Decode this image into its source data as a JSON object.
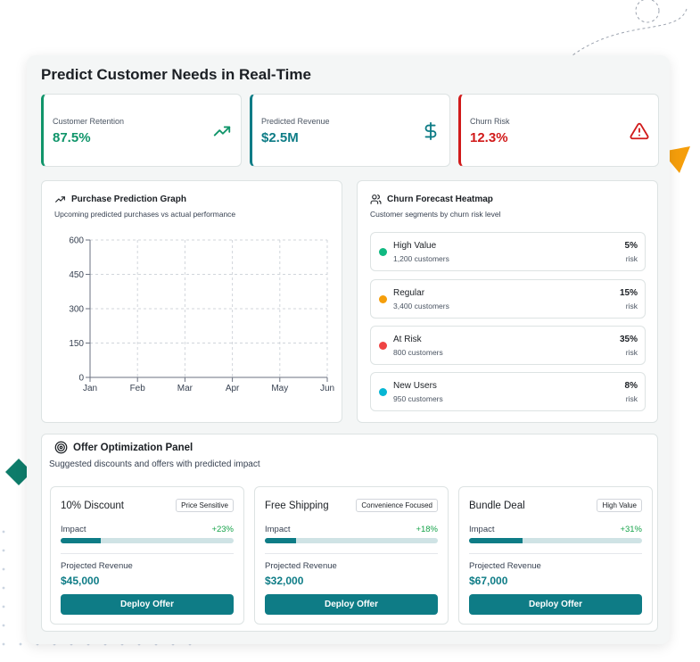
{
  "title": "Predict Customer Needs in Real-Time",
  "kpis": [
    {
      "label": "Customer Retention",
      "value": "87.5%",
      "color": "#10956a",
      "icon": "trending-up-icon"
    },
    {
      "label": "Predicted Revenue",
      "value": "$2.5M",
      "color": "#0e7c86",
      "icon": "dollar-icon"
    },
    {
      "label": "Churn Risk",
      "value": "12.3%",
      "color": "#d11a1a",
      "icon": "warning-icon"
    }
  ],
  "graph": {
    "title": "Purchase Prediction Graph",
    "subtitle": "Upcoming predicted purchases vs actual performance",
    "icon": "trending-up-icon"
  },
  "chart_data": {
    "type": "line",
    "categories": [
      "Jan",
      "Feb",
      "Mar",
      "Apr",
      "May",
      "Jun"
    ],
    "yticks": [
      "0",
      "150",
      "300",
      "450",
      "600"
    ],
    "ylim": [
      0,
      600
    ],
    "series": [],
    "grid": true
  },
  "heatmap": {
    "title": "Churn Forecast Heatmap",
    "subtitle": "Customer segments by churn risk level",
    "icon": "users-icon",
    "segments": [
      {
        "name": "High Value",
        "count": "1,200 customers",
        "pct": "5%",
        "risk": "risk",
        "color": "#10b981"
      },
      {
        "name": "Regular",
        "count": "3,400 customers",
        "pct": "15%",
        "risk": "risk",
        "color": "#f59e0b"
      },
      {
        "name": "At Risk",
        "count": "800 customers",
        "pct": "35%",
        "risk": "risk",
        "color": "#ef4444"
      },
      {
        "name": "New Users",
        "count": "950 customers",
        "pct": "8%",
        "risk": "risk",
        "color": "#06b6d4"
      }
    ]
  },
  "offers": {
    "title": "Offer Optimization Panel",
    "subtitle": "Suggested discounts and offers with predicted impact",
    "icon": "target-icon",
    "items": [
      {
        "name": "10% Discount",
        "tag": "Price Sensitive",
        "impact_label": "Impact",
        "impact": "+23%",
        "impact_level": 0.23,
        "revenue_label": "Projected Revenue",
        "revenue": "$45,000",
        "button": "Deploy Offer"
      },
      {
        "name": "Free Shipping",
        "tag": "Convenience Focused",
        "impact_label": "Impact",
        "impact": "+18%",
        "impact_level": 0.18,
        "revenue_label": "Projected Revenue",
        "revenue": "$32,000",
        "button": "Deploy Offer"
      },
      {
        "name": "Bundle Deal",
        "tag": "High Value",
        "impact_label": "Impact",
        "impact": "+31%",
        "impact_level": 0.31,
        "revenue_label": "Projected Revenue",
        "revenue": "$67,000",
        "button": "Deploy Offer"
      }
    ]
  },
  "colors": {
    "accent": "#0e7c86",
    "triangle": "#f59e0b",
    "diamond": "#0e7c6a"
  }
}
